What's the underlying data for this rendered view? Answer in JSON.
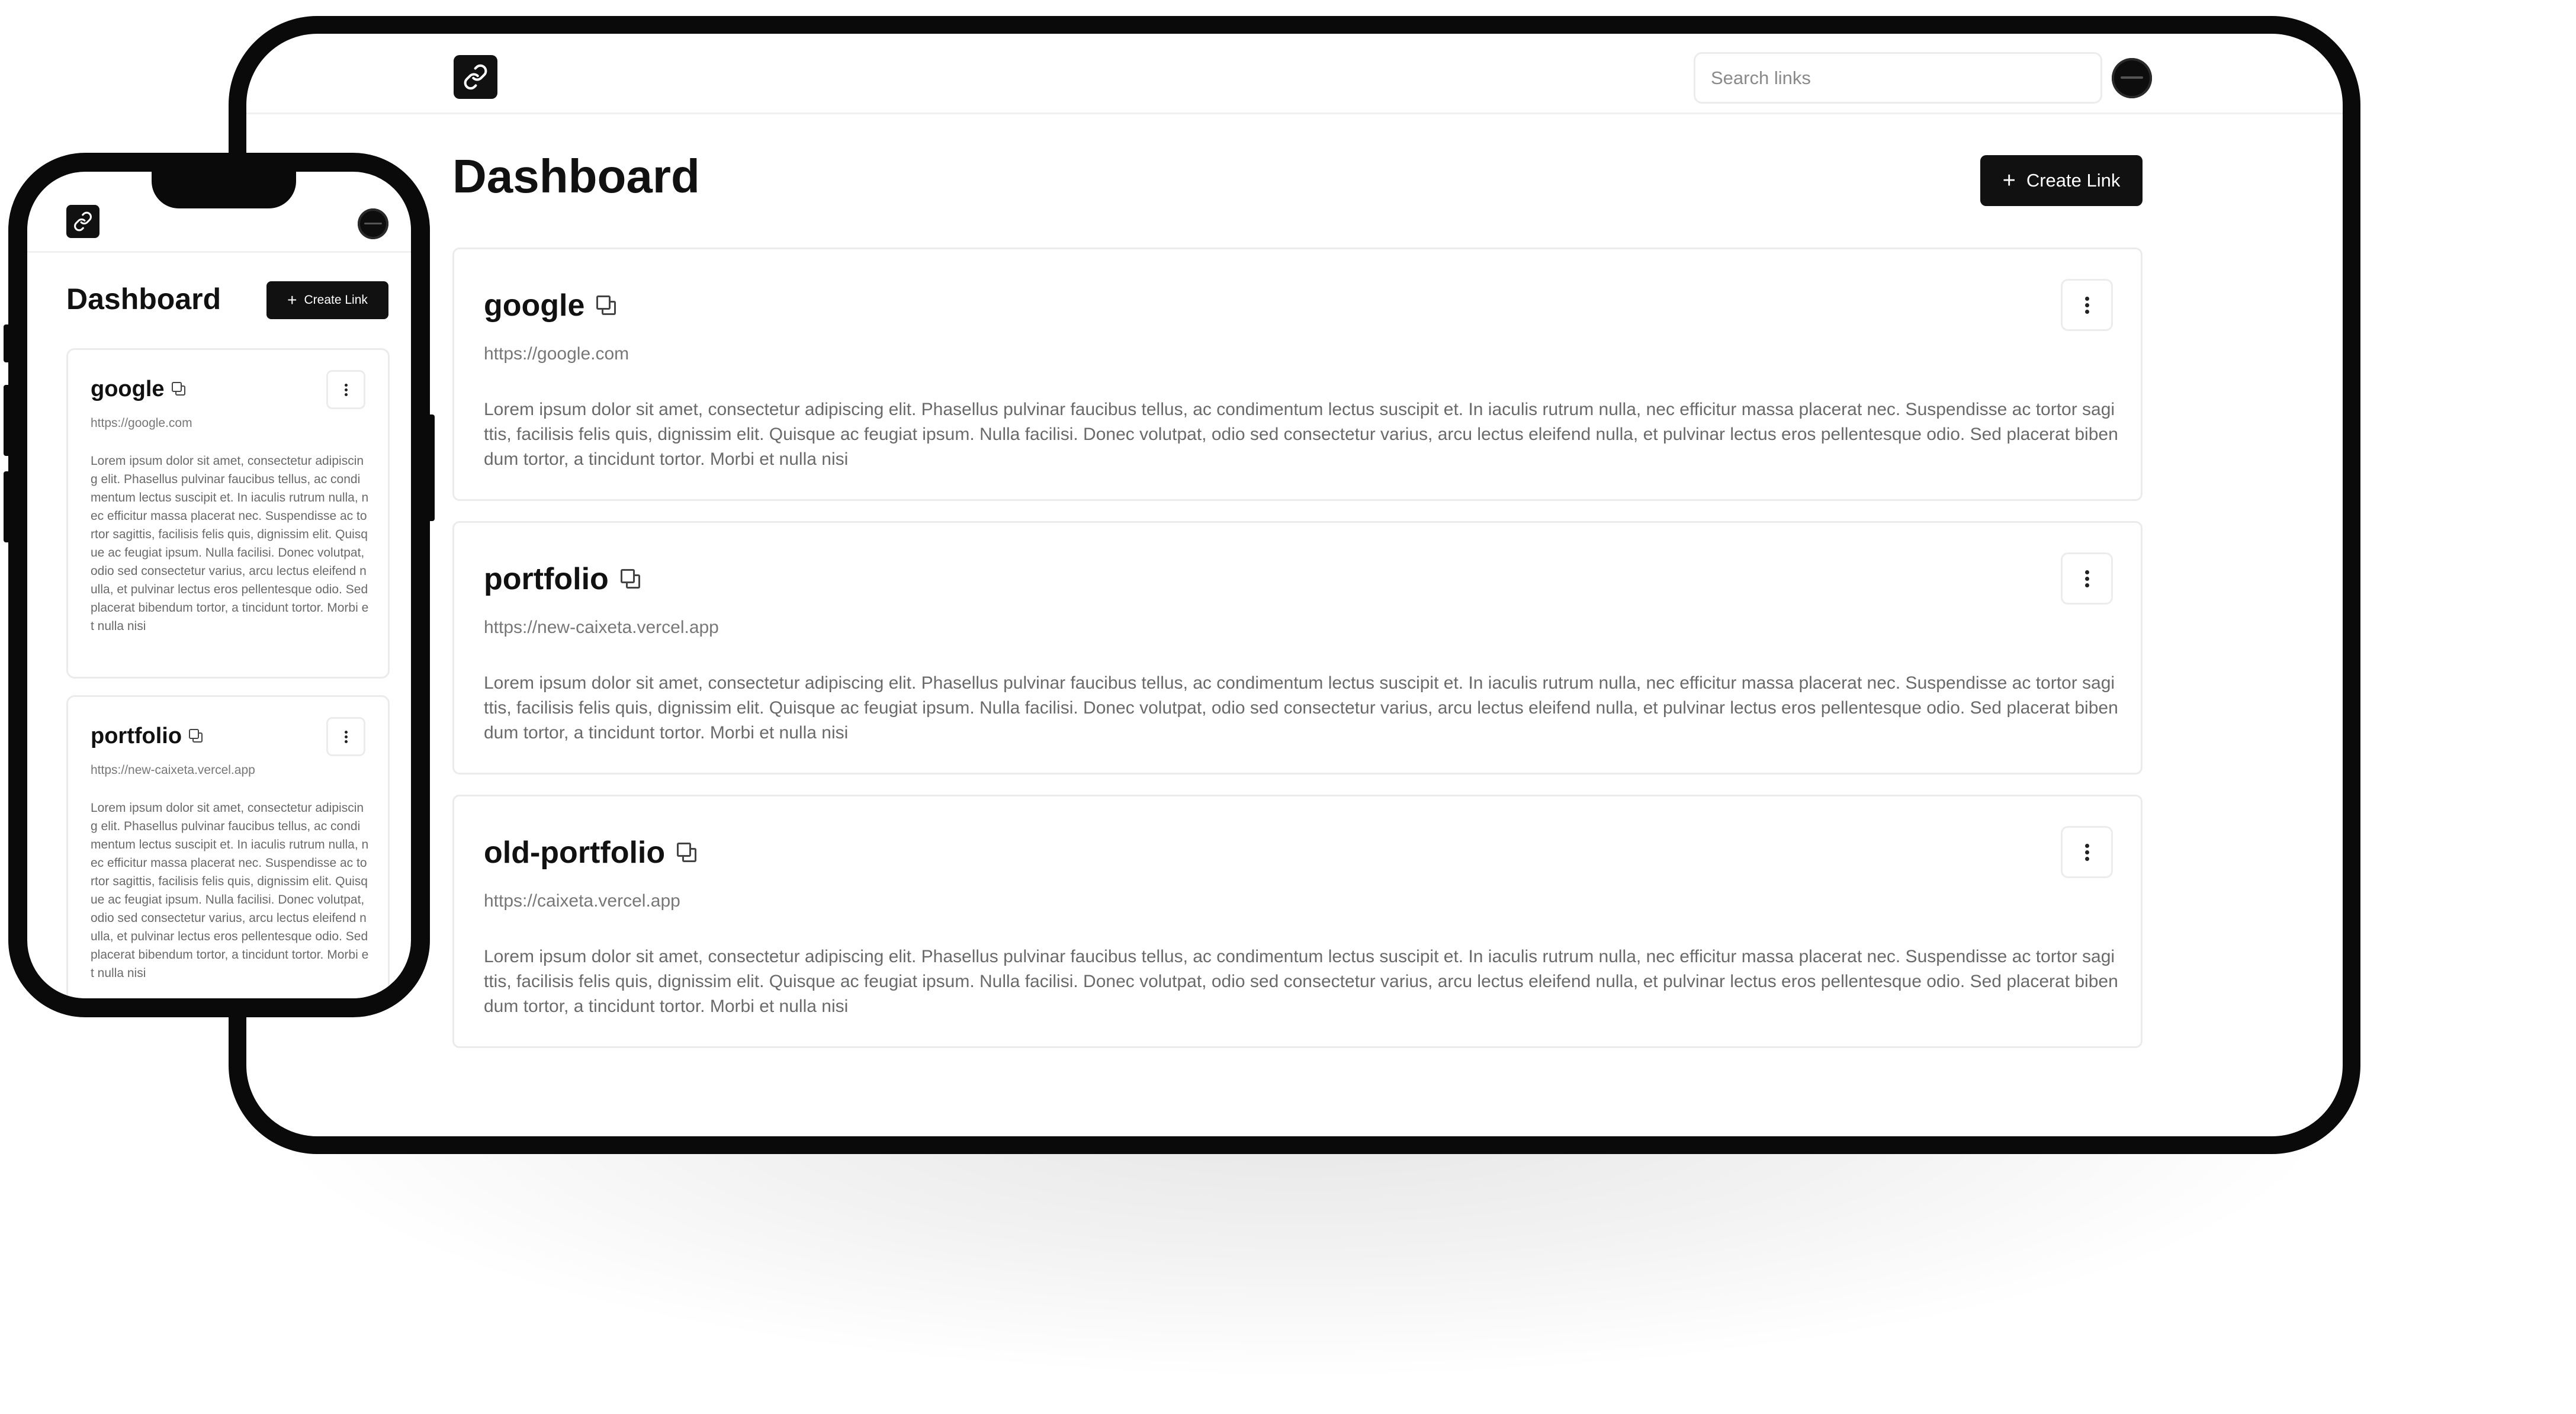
{
  "app": {
    "search_placeholder": "Search links",
    "page_title": "Dashboard",
    "create_label": "Create Link",
    "create_icon": "plus-icon",
    "logo_icon": "link-icon",
    "colors": {
      "primary": "#111111",
      "card_border": "#ebebeb",
      "muted_text": "#777777"
    }
  },
  "links": [
    {
      "name": "google",
      "url": "https://google.com",
      "description": "Lorem ipsum dolor sit amet, consectetur adipiscing elit. Phasellus pulvinar faucibus tellus, ac condimentum lectus suscipit et. In iaculis rutrum nulla, nec efficitur massa placerat nec. Suspendisse ac tortor sagittis, facilisis felis quis, dignissim elit. Quisque ac feugiat ipsum. Nulla facilisi. Donec volutpat, odio sed consectetur varius, arcu lectus eleifend nulla, et pulvinar lectus eros pellentesque odio. Sed placerat bibendum tortor, a tincidunt tortor. Morbi et nulla nisi"
    },
    {
      "name": "portfolio",
      "url": "https://new-caixeta.vercel.app",
      "description": "Lorem ipsum dolor sit amet, consectetur adipiscing elit. Phasellus pulvinar faucibus tellus, ac condimentum lectus suscipit et. In iaculis rutrum nulla, nec efficitur massa placerat nec. Suspendisse ac tortor sagittis, facilisis felis quis, dignissim elit. Quisque ac feugiat ipsum. Nulla facilisi. Donec volutpat, odio sed consectetur varius, arcu lectus eleifend nulla, et pulvinar lectus eros pellentesque odio. Sed placerat bibendum tortor, a tincidunt tortor. Morbi et nulla nisi"
    },
    {
      "name": "old-portfolio",
      "url": "https://caixeta.vercel.app",
      "description": "Lorem ipsum dolor sit amet, consectetur adipiscing elit. Phasellus pulvinar faucibus tellus, ac condimentum lectus suscipit et. In iaculis rutrum nulla, nec efficitur massa placerat nec. Suspendisse ac tortor sagittis, facilisis felis quis, dignissim elit. Quisque ac feugiat ipsum. Nulla facilisi. Donec volutpat, odio sed consectetur varius, arcu lectus eleifend nulla, et pulvinar lectus eros pellentesque odio. Sed placerat bibendum tortor, a tincidunt tortor. Morbi et nulla nisi"
    }
  ]
}
